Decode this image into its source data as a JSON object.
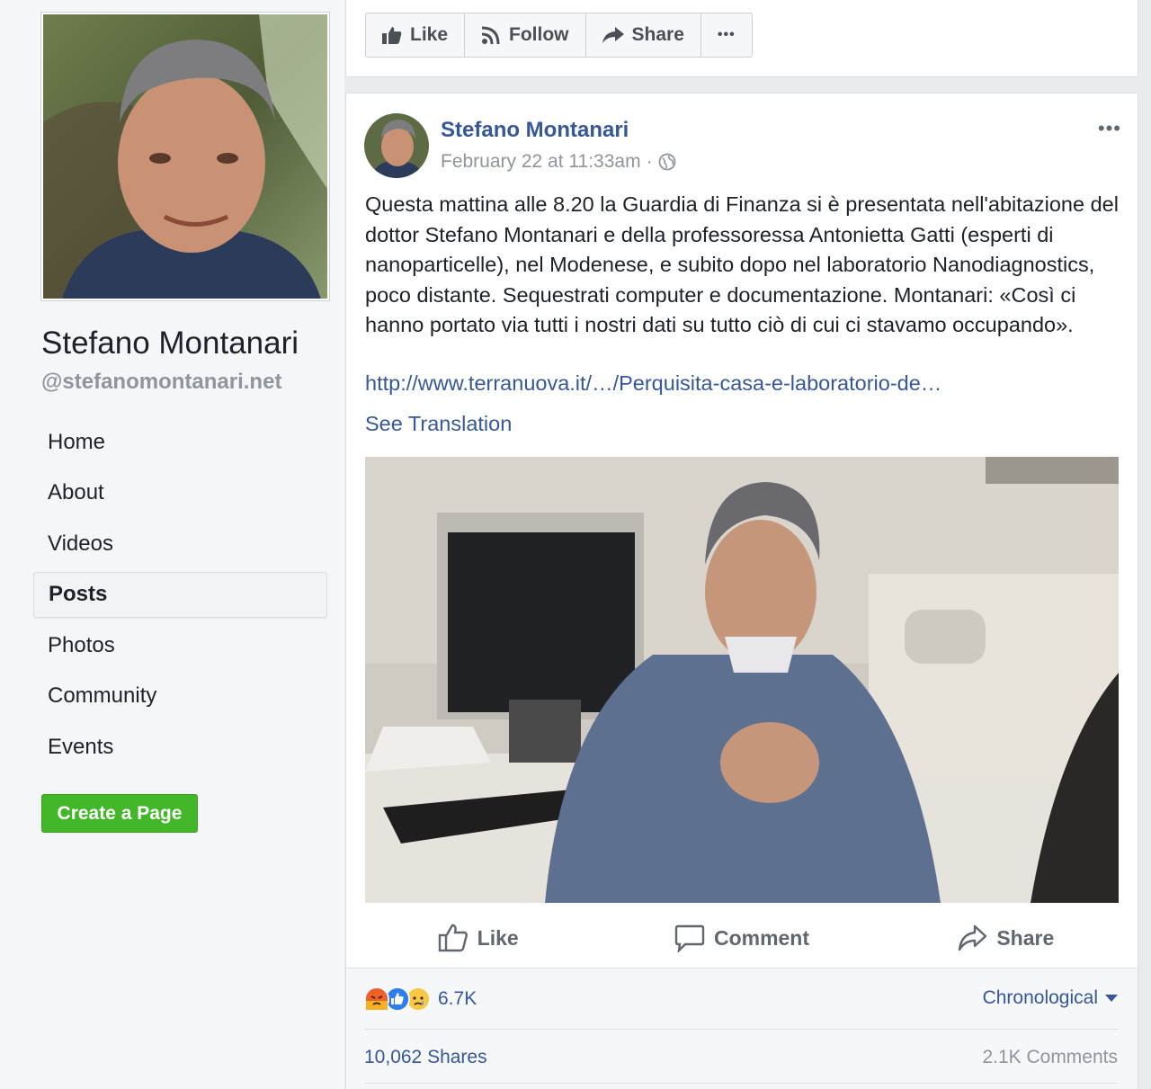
{
  "page": {
    "name": "Stefano Montanari",
    "handle": "@stefanomontanari.net"
  },
  "nav": {
    "items": [
      {
        "label": "Home"
      },
      {
        "label": "About"
      },
      {
        "label": "Videos"
      },
      {
        "label": "Posts",
        "active": true
      },
      {
        "label": "Photos"
      },
      {
        "label": "Community"
      },
      {
        "label": "Events"
      }
    ],
    "create_page": "Create a Page"
  },
  "topbar": {
    "like": "Like",
    "follow": "Follow",
    "share": "Share",
    "more": "•••"
  },
  "post": {
    "author": "Stefano Montanari",
    "timestamp": "February 22 at 11:33am",
    "separator": "·",
    "text": "Questa mattina alle 8.20 la Guardia di Finanza si è presentata nell'abitazione del dottor Stefano Montanari e della professoressa Antonietta Gatti (esperti di nanoparticelle), nel Modenese, e subito dopo nel laboratorio Nanodiagnostics, poco distante. Sequestrati computer e documentazione. Montanari: «Così ci hanno portato via tutti i nostri dati su tutto ciò di cui ci stavamo occupando».",
    "link": "http://www.terranuova.it/…/Perquisita-casa-e-laboratorio-de…",
    "see_translation": "See Translation",
    "more": "•••"
  },
  "actions": {
    "like": "Like",
    "comment": "Comment",
    "share": "Share"
  },
  "footer": {
    "reaction_count": "6.7K",
    "sort_label": "Chronological",
    "shares": "10,062 Shares",
    "comments": "2.1K Comments"
  },
  "colors": {
    "link": "#365899",
    "create_button": "#42b72a",
    "background": "#e9ebee"
  }
}
